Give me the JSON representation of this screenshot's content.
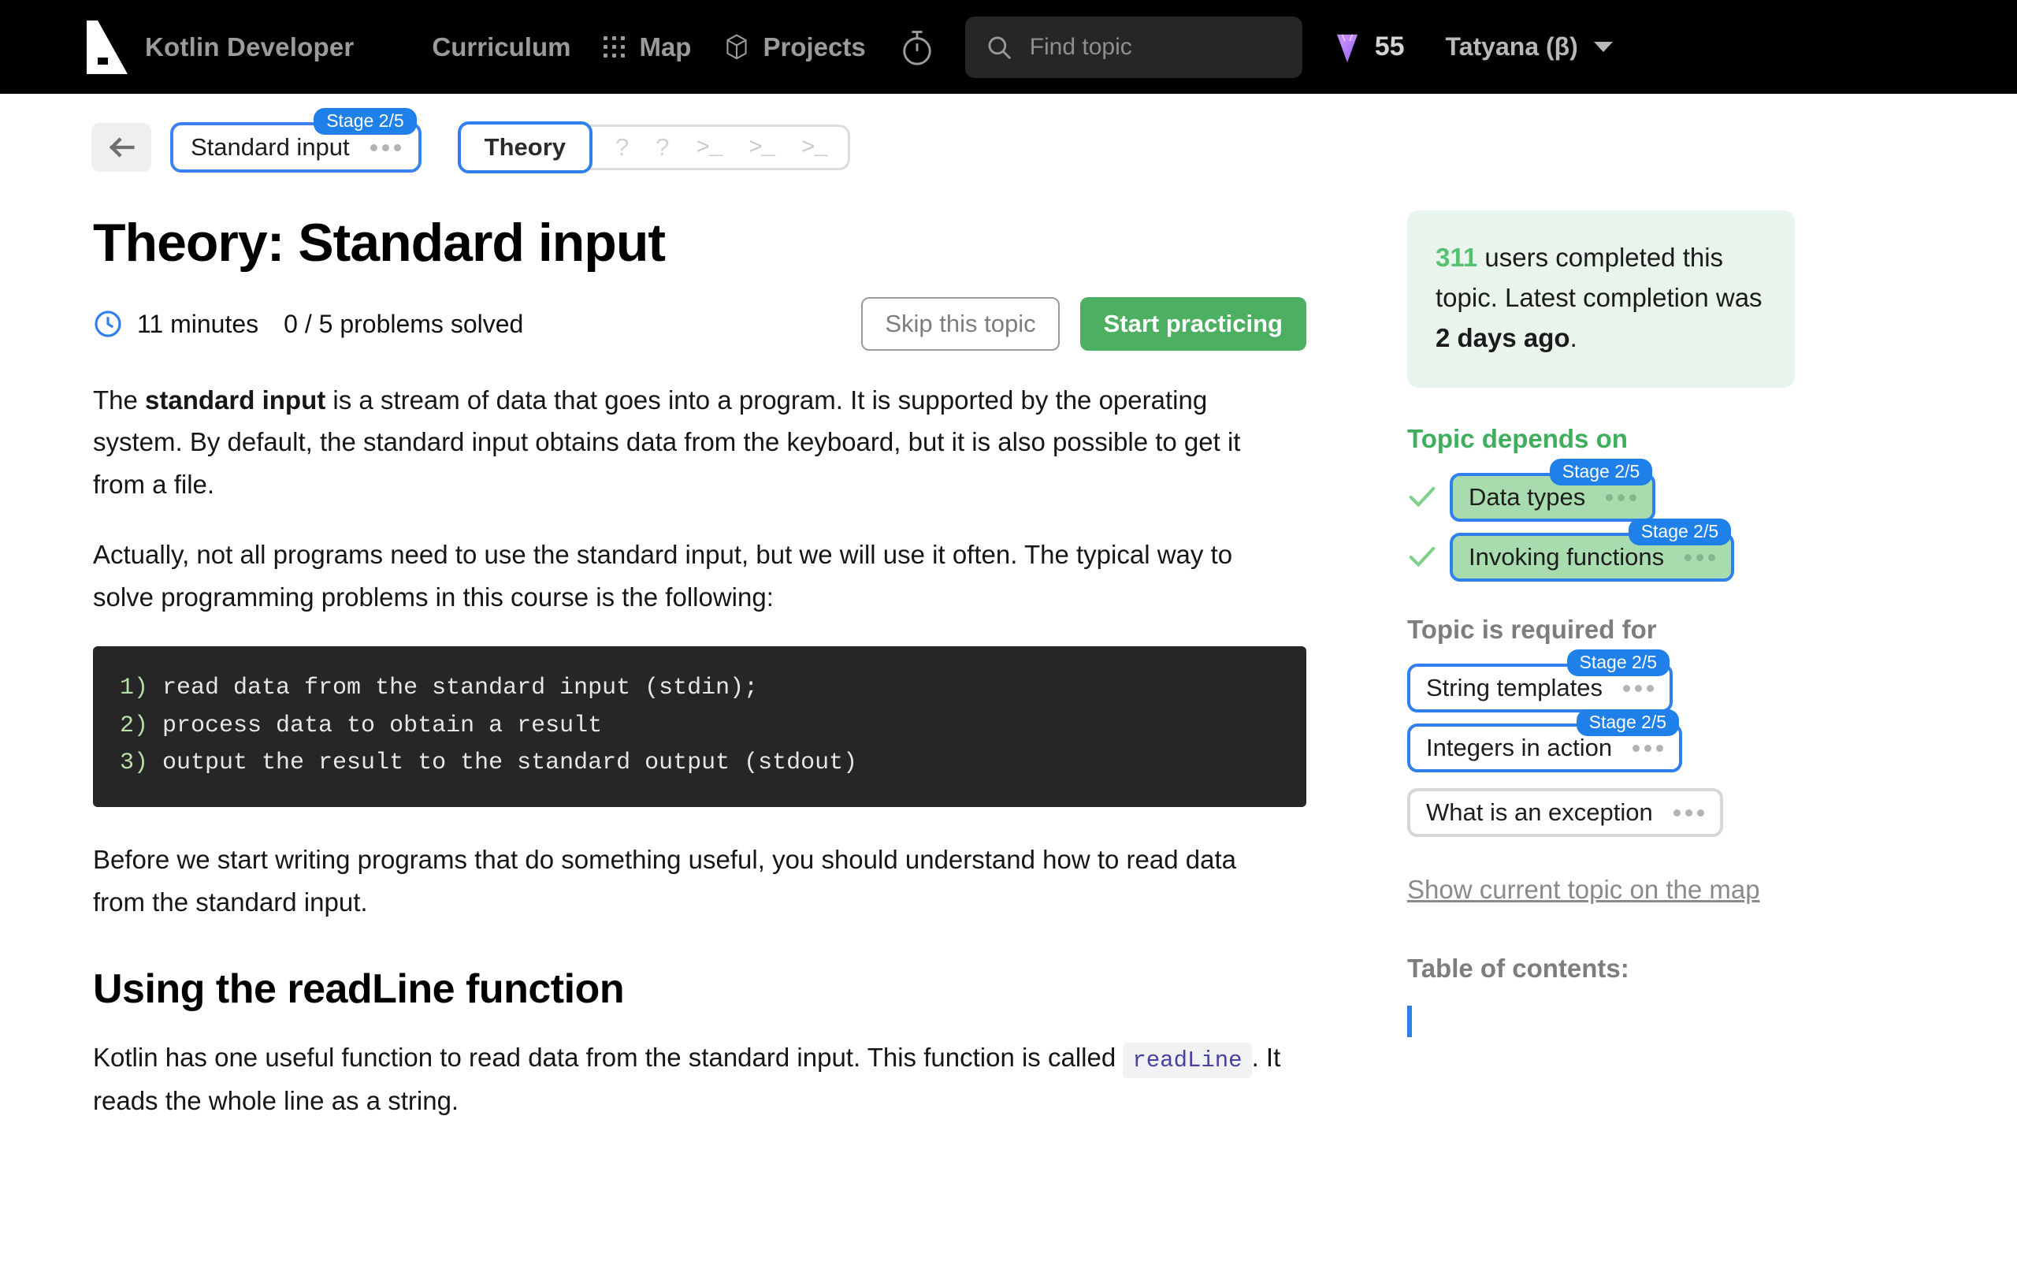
{
  "topnav": {
    "brand": "Kotlin Developer",
    "items": [
      {
        "label": "Curriculum",
        "icon": "hamburger-icon"
      },
      {
        "label": "Map",
        "icon": "grid-dots-icon"
      },
      {
        "label": "Projects",
        "icon": "cube-icon"
      }
    ],
    "timer_icon": "stopwatch-icon",
    "search": {
      "placeholder": "Find topic",
      "value": "",
      "icon": "search-icon"
    },
    "gems": {
      "icon": "gem-icon",
      "count": "55"
    },
    "profile": {
      "label": "Tatyana (β)",
      "icon": "chevron-down-icon"
    }
  },
  "crumbbar": {
    "back_icon": "arrow-left-icon",
    "topic_pill": {
      "label": "Standard input",
      "badge": "Stage 2/5",
      "menu_icon": "ellipsis-icon"
    },
    "tabs": {
      "active": "Theory",
      "others": [
        "?",
        "?",
        ">_",
        ">_",
        ">_"
      ]
    }
  },
  "main": {
    "title": "Theory: Standard input",
    "duration": "11 minutes",
    "progress": "0 / 5 problems solved",
    "clock_icon": "clock-icon",
    "skip_label": "Skip this topic",
    "practice_label": "Start practicing",
    "p1_a": "The ",
    "p1_bold": "standard input",
    "p1_b": " is a stream of data that goes into a program. It is supported by the operating system. By default, the standard input obtains data from the keyboard, but it is also possible to get it from a file.",
    "p2": "Actually, not all programs need to use the standard input, but we will use it often. The typical way to solve programming problems in this course is the following:",
    "code_lines": [
      {
        "num": "1)",
        "text": " read data from the standard input (stdin);"
      },
      {
        "num": "2)",
        "text": " process data to obtain a result"
      },
      {
        "num": "3)",
        "text": " output the result to the standard output (stdout)"
      }
    ],
    "p3": "Before we start writing programs that do something useful, you should understand how to read data from the standard input.",
    "subtitle": "Using the readLine function",
    "p4_a": "Kotlin has one useful function to read data from the standard input. This function is called ",
    "p4_code": "readLine",
    "p4_b": ". It reads the whole line as a string."
  },
  "sidebar": {
    "stats": {
      "count": "311",
      "text_a": " users completed this topic. Latest completion was ",
      "bold": "2 days ago",
      "text_b": "."
    },
    "depends_head": "Topic depends on",
    "depends": [
      {
        "label": "Data types",
        "badge": "Stage 2/5",
        "completed": true
      },
      {
        "label": "Invoking functions",
        "badge": "Stage 2/5",
        "completed": true
      }
    ],
    "required_head": "Topic is required for",
    "required": [
      {
        "label": "String templates",
        "badge": "Stage 2/5",
        "outlined": true
      },
      {
        "label": "Integers in action",
        "badge": "Stage 2/5",
        "outlined": true
      },
      {
        "label": "What is an exception",
        "badge": "",
        "outlined": false
      }
    ],
    "map_link": "Show current topic on the map",
    "toc_head": "Table of contents:"
  }
}
